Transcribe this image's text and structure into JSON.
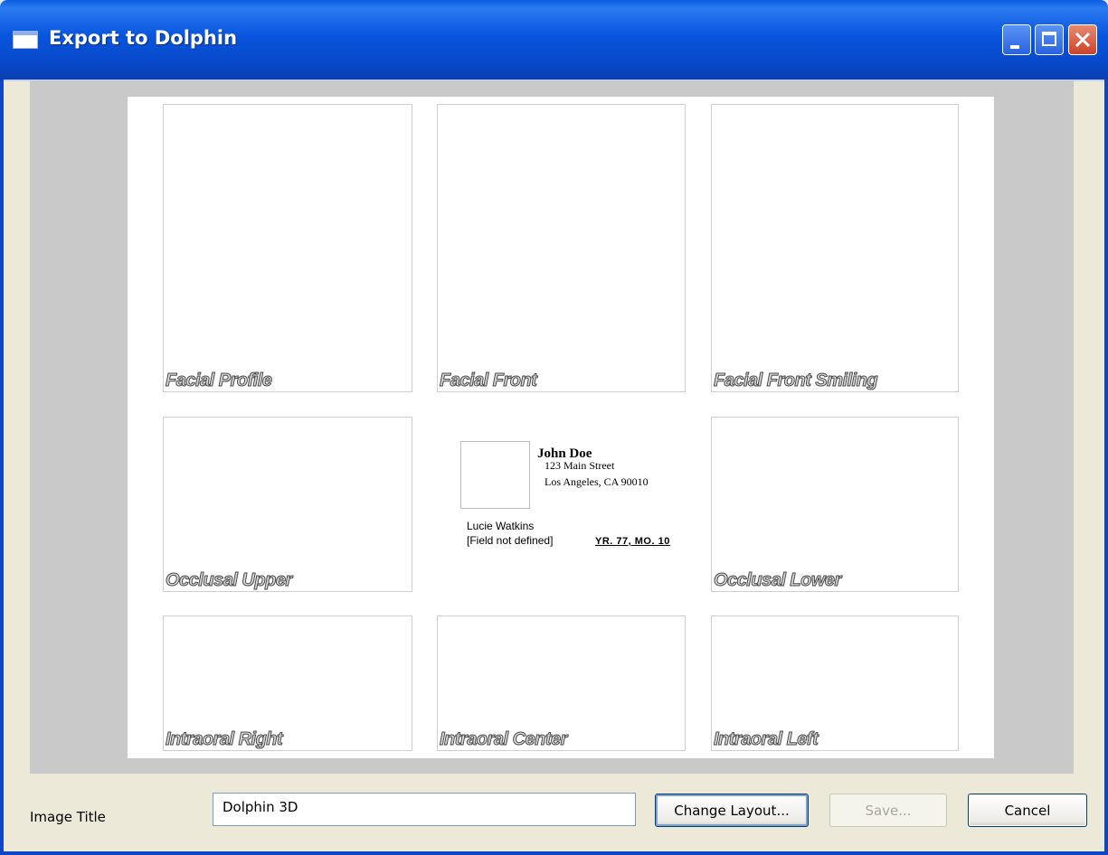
{
  "window": {
    "title": "Export to Dolphin"
  },
  "slots": [
    {
      "label": "Facial Profile"
    },
    {
      "label": "Facial Front"
    },
    {
      "label": "Facial Front Smiling"
    },
    {
      "label": "Occlusal Upper"
    },
    {
      "label": "Occlusal Lower"
    },
    {
      "label": "Intraoral Right"
    },
    {
      "label": "Intraoral Center"
    },
    {
      "label": "Intraoral Left"
    }
  ],
  "info": {
    "practice_name": "John Doe",
    "address_line1": "123 Main Street",
    "address_line2": "Los Angeles, CA 90010",
    "patient_name": "Lucie Watkins",
    "field_text": "[Field not defined]",
    "age_text": "YR. 77, MO. 10"
  },
  "footer": {
    "image_title_label": "Image Title",
    "image_title_value": "Dolphin 3D",
    "change_layout_label": "Change Layout...",
    "save_label": "Save...",
    "cancel_label": "Cancel"
  }
}
